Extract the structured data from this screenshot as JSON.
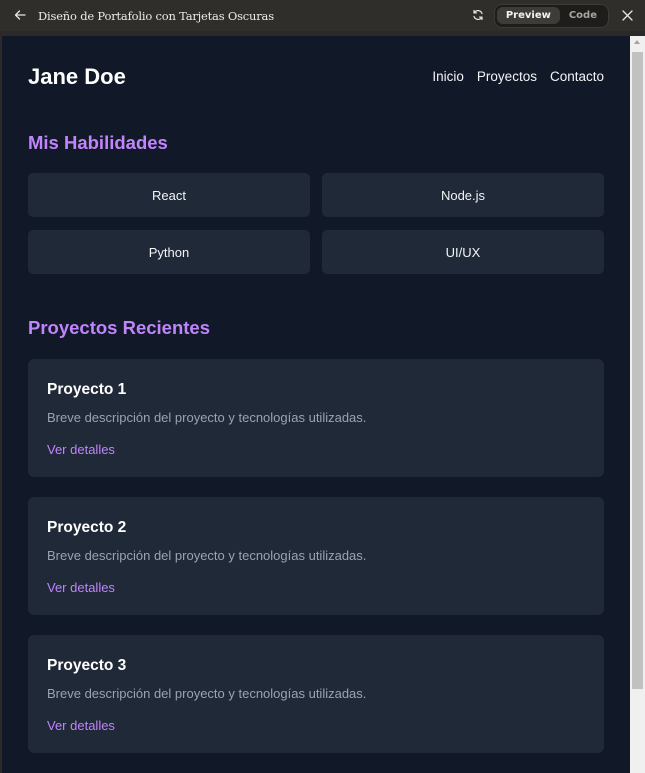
{
  "window": {
    "title": "Diseño de Portafolio con Tarjetas Oscuras",
    "toggle": {
      "preview_label": "Preview",
      "code_label": "Code",
      "active": "Preview"
    }
  },
  "site": {
    "brand": "Jane Doe",
    "nav": [
      "Inicio",
      "Proyectos",
      "Contacto"
    ],
    "skills_title": "Mis Habilidades",
    "skills": [
      "React",
      "Node.js",
      "Python",
      "UI/UX"
    ],
    "projects_title": "Proyectos Recientes",
    "projects": [
      {
        "title": "Proyecto 1",
        "description": "Breve descripción del proyecto y tecnologías utilizadas.",
        "link": "Ver detalles"
      },
      {
        "title": "Proyecto 2",
        "description": "Breve descripción del proyecto y tecnologías utilizadas.",
        "link": "Ver detalles"
      },
      {
        "title": "Proyecto 3",
        "description": "Breve descripción del proyecto y tecnologías utilizadas.",
        "link": "Ver detalles"
      }
    ]
  },
  "colors": {
    "page_bg": "#111827",
    "card_bg": "#1f2937",
    "accent": "#c084fc",
    "muted_text": "#9ca3af"
  },
  "icons": [
    "arrow-left-icon",
    "refresh-icon",
    "close-icon"
  ]
}
